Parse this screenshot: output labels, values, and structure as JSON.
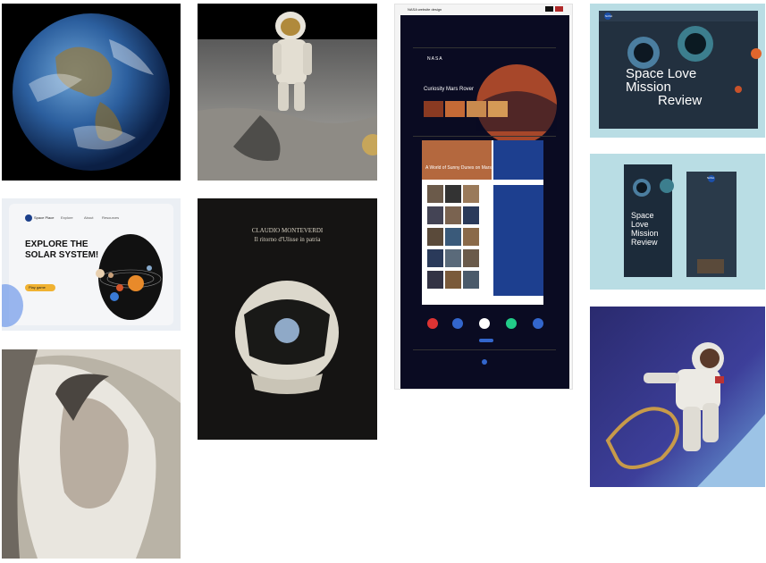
{
  "board": {
    "tiles": [
      {
        "id": "earth",
        "label": "Earth from space"
      },
      {
        "id": "moonwalk",
        "label": "Astronaut on the Moon"
      },
      {
        "id": "nasa-site",
        "label": "NASA website mockup"
      },
      {
        "id": "space-love-1",
        "label": "Space Love Mission Review"
      },
      {
        "id": "space-love-mobile",
        "label": "Space Love Mission Review mobile"
      },
      {
        "id": "solar-system",
        "label": "Explore the Solar System"
      },
      {
        "id": "monteverdi",
        "label": "Claudio Monteverdi poster"
      },
      {
        "id": "helmet-portrait",
        "label": "Astronaut portrait"
      },
      {
        "id": "spacewalk",
        "label": "Spacewalk"
      }
    ]
  },
  "nasa_site": {
    "header_title": "NASA website design",
    "nav_logo": "NASA",
    "hero_title": "Curiosity Mars Rover",
    "feature_title": "A World of Sunny Dunes on Mars"
  },
  "space_love": {
    "title_line1": "Space Love",
    "title_line2": "Mission",
    "title_line3": "Review",
    "mobile_line1": "Space",
    "mobile_line2": "Love",
    "mobile_line3": "Mission",
    "mobile_line4": "Review",
    "logo": "NASA"
  },
  "solar": {
    "brand": "Space Place",
    "nav1": "Explore",
    "nav2": "About",
    "nav3": "Resources",
    "headline1": "EXPLORE THE",
    "headline2": "SOLAR SYSTEM!",
    "cta": "Play game"
  },
  "poster": {
    "composer": "CLAUDIO MONTEVERDI",
    "opera": "Il ritorno d'Ulisse in patria"
  }
}
